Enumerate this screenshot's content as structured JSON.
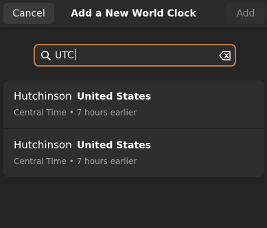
{
  "header": {
    "title": "Add a New World Clock",
    "cancel_label": "Cancel",
    "add_label": "Add"
  },
  "search": {
    "value": "UTC",
    "icon": "search-icon",
    "clear_icon": "clear-text-icon"
  },
  "results": [
    {
      "city": "Hutchinson",
      "country": "United States",
      "detail": "Central Time • 7 hours earlier"
    },
    {
      "city": "Hutchinson",
      "country": "United States",
      "detail": "Central Time • 7 hours earlier"
    }
  ],
  "colors": {
    "background": "#242424",
    "focus_accent": "#c07a4a",
    "list_background": "#2e2e2e"
  }
}
